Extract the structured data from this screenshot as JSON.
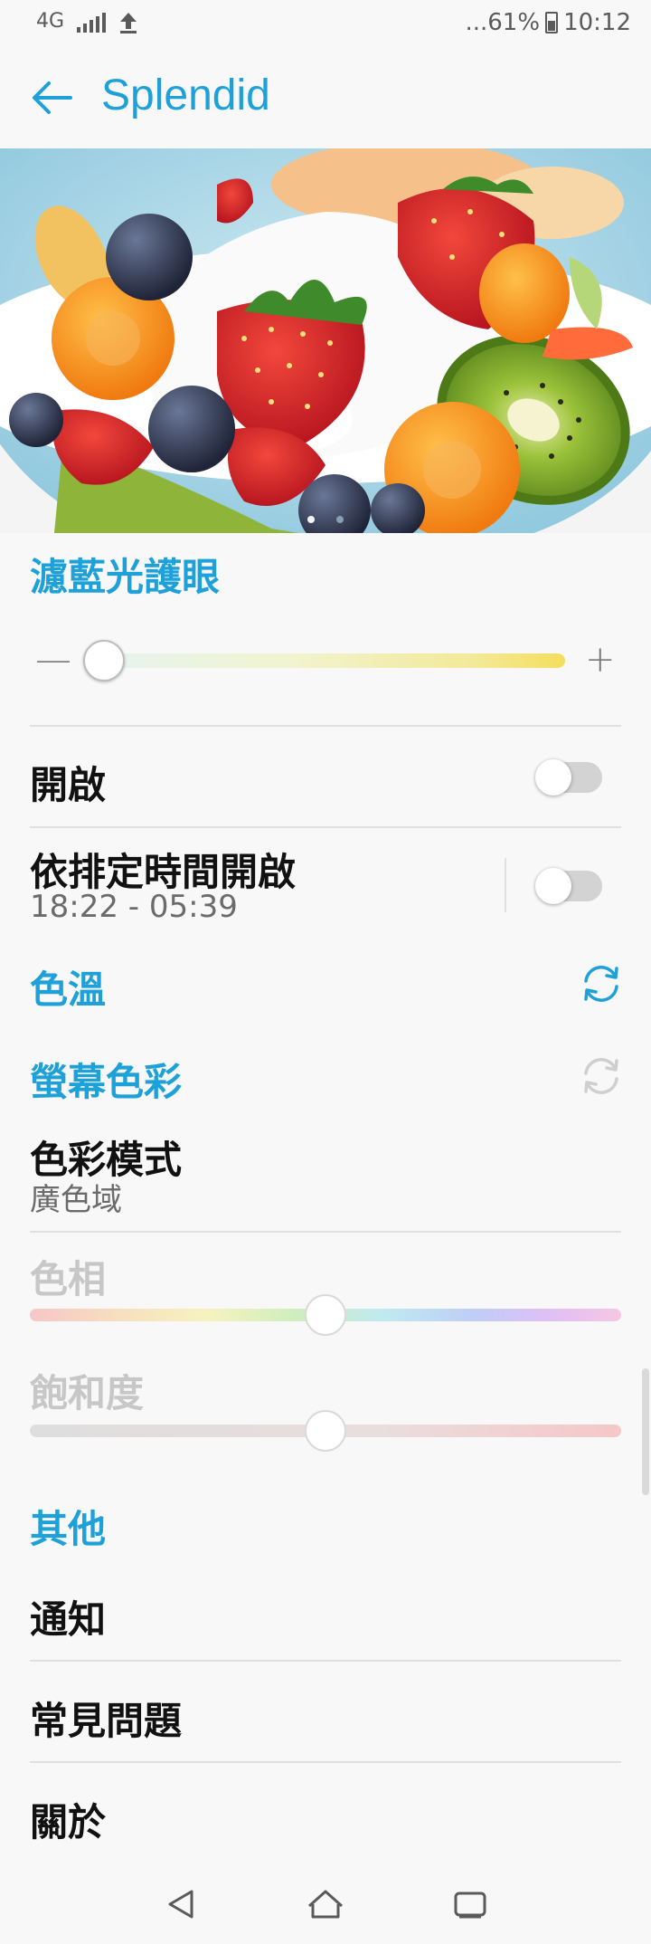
{
  "status_bar": {
    "network": "4G",
    "battery_text": "...61%",
    "time": "10:12"
  },
  "app_bar": {
    "title": "Splendid"
  },
  "hero": {
    "page_count": 2,
    "active_page": 1
  },
  "blue_light": {
    "section_title": "濾藍光護眼",
    "slider_minus": "—",
    "slider_plus": "+",
    "slider_value": 0.0,
    "on_label": "開啟",
    "on_enabled": false,
    "schedule_label": "依排定時間開啟",
    "schedule_time": "18:22 - 05:39",
    "schedule_enabled": false
  },
  "color_temp": {
    "section_title": "色溫"
  },
  "screen_color": {
    "section_title": "螢幕色彩",
    "mode_label": "色彩模式",
    "mode_value": "廣色域",
    "hue_label": "色相",
    "hue_value": 0.5,
    "saturation_label": "飽和度",
    "saturation_value": 0.5
  },
  "other": {
    "section_title": "其他",
    "items": [
      {
        "label": "通知"
      },
      {
        "label": "常見問題"
      },
      {
        "label": "關於"
      }
    ]
  },
  "colors": {
    "accent": "#1ea0d8",
    "toggle_off": "#d3d3d3"
  },
  "icons": {
    "back": "arrow-left-icon",
    "reset": "refresh-icon",
    "nav_back": "triangle-back-icon",
    "nav_home": "home-icon",
    "nav_recents": "recents-icon"
  }
}
